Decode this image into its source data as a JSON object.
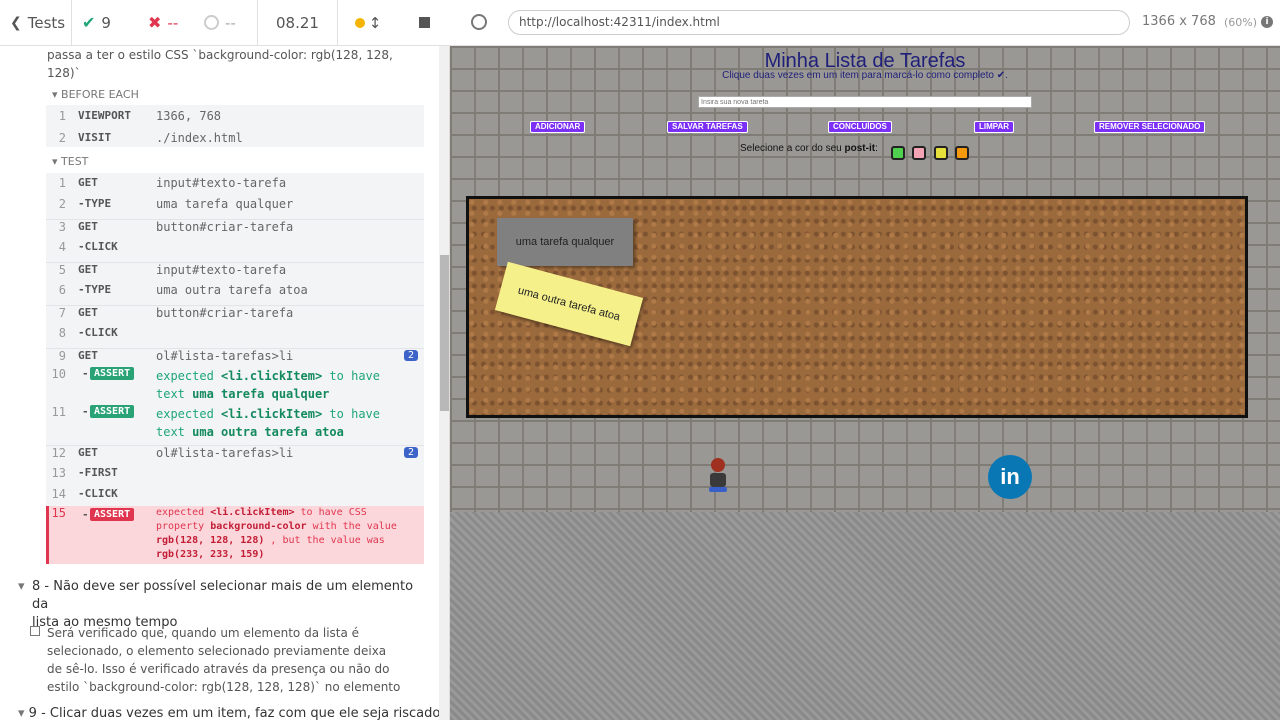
{
  "topbar": {
    "tests_label": "Tests",
    "passed": "9",
    "failed": "--",
    "pending": "--",
    "duration": "08.21"
  },
  "address": {
    "url": "http://localhost:42311/index.html",
    "viewport_size": "1366 x 768",
    "scale": "(60%)"
  },
  "panel": {
    "prev_desc": "passa a ter o estilo CSS `background-color: rgb(128, 128, 128)`",
    "before_each_label": "BEFORE EACH",
    "test_label": "TEST",
    "before_each": [
      {
        "n": "1",
        "cmd": "VIEWPORT",
        "arg": "1366, 768"
      },
      {
        "n": "2",
        "cmd": "VISIT",
        "arg": "./index.html"
      }
    ],
    "steps": [
      {
        "n": "1",
        "cmd": "GET",
        "arg": "input#texto-tarefa"
      },
      {
        "n": "2",
        "cmd": "-TYPE",
        "arg": "uma tarefa qualquer"
      },
      {
        "n": "3",
        "cmd": "GET",
        "arg": "button#criar-tarefa"
      },
      {
        "n": "4",
        "cmd": "-CLICK",
        "arg": ""
      },
      {
        "n": "5",
        "cmd": "GET",
        "arg": "input#texto-tarefa"
      },
      {
        "n": "6",
        "cmd": "-TYPE",
        "arg": "uma outra tarefa atoa"
      },
      {
        "n": "7",
        "cmd": "GET",
        "arg": "button#criar-tarefa"
      },
      {
        "n": "8",
        "cmd": "-CLICK",
        "arg": ""
      },
      {
        "n": "9",
        "cmd": "GET",
        "arg": "ol#lista-tarefas>li",
        "count": "2"
      },
      {
        "n": "12",
        "cmd": "GET",
        "arg": "ol#lista-tarefas>li",
        "count": "2"
      },
      {
        "n": "13",
        "cmd": "-FIRST",
        "arg": ""
      },
      {
        "n": "14",
        "cmd": "-CLICK",
        "arg": ""
      }
    ],
    "assert_label": "ASSERT",
    "assert10": {
      "n": "10",
      "a": "expected",
      "b": "<li.clickItem>",
      "c": "to have",
      "d": "text",
      "e": "uma tarefa qualquer"
    },
    "assert11": {
      "n": "11",
      "a": "expected",
      "b": "<li.clickItem>",
      "c": "to have",
      "d": "text",
      "e": "uma outra tarefa atoa"
    },
    "failed_assert": {
      "n": "15",
      "l1a": "expected",
      "l1b": "<li.clickItem>",
      "l1c": "to have CSS",
      "l2a": "property",
      "l2b": "background-color",
      "l2c": "with the value",
      "l3a": "rgb(128, 128, 128)",
      "l3b": ", but the value was",
      "l4": "rgb(233, 233, 159)"
    },
    "test8_title_1": "8 - Não deve ser possível selecionar mais de um elemento da",
    "test8_title_2": "lista ao mesmo tempo",
    "test8_desc": [
      "Será verificado que, quando um elemento da lista é",
      "selecionado, o elemento selecionado previamente deixa",
      "de sê-lo. Isso é verificado através da presença ou não do",
      "estilo `background-color: rgb(128, 128, 128)` no elemento"
    ],
    "test9_title": "9 - Clicar duas vezes em um item, faz com que ele seja riscado,"
  },
  "app": {
    "title": "Minha Lista de Tarefas",
    "subtitle": "Clique duas vezes em um item para marcá-lo como completo ✔.",
    "input_placeholder": "Insira sua nova tarefa",
    "buttons": [
      "ADICIONAR",
      "SALVAR TAREFAS",
      "CONCLUÍDOS",
      "LIMPAR",
      "REMOVER SELECIONADO"
    ],
    "color_label": "Selecione a cor do seu",
    "color_label_bold": "post-it",
    "color_label_end": ":",
    "swatch_colors": [
      "#4fd14f",
      "#f4a3b4",
      "#e6e03c",
      "#f59a0c"
    ],
    "notes": [
      "uma tarefa qualquer",
      "uma outra tarefa atoa"
    ],
    "note_colors": [
      "#808080",
      "#f5f08a"
    ],
    "linkedin_label": "in"
  }
}
